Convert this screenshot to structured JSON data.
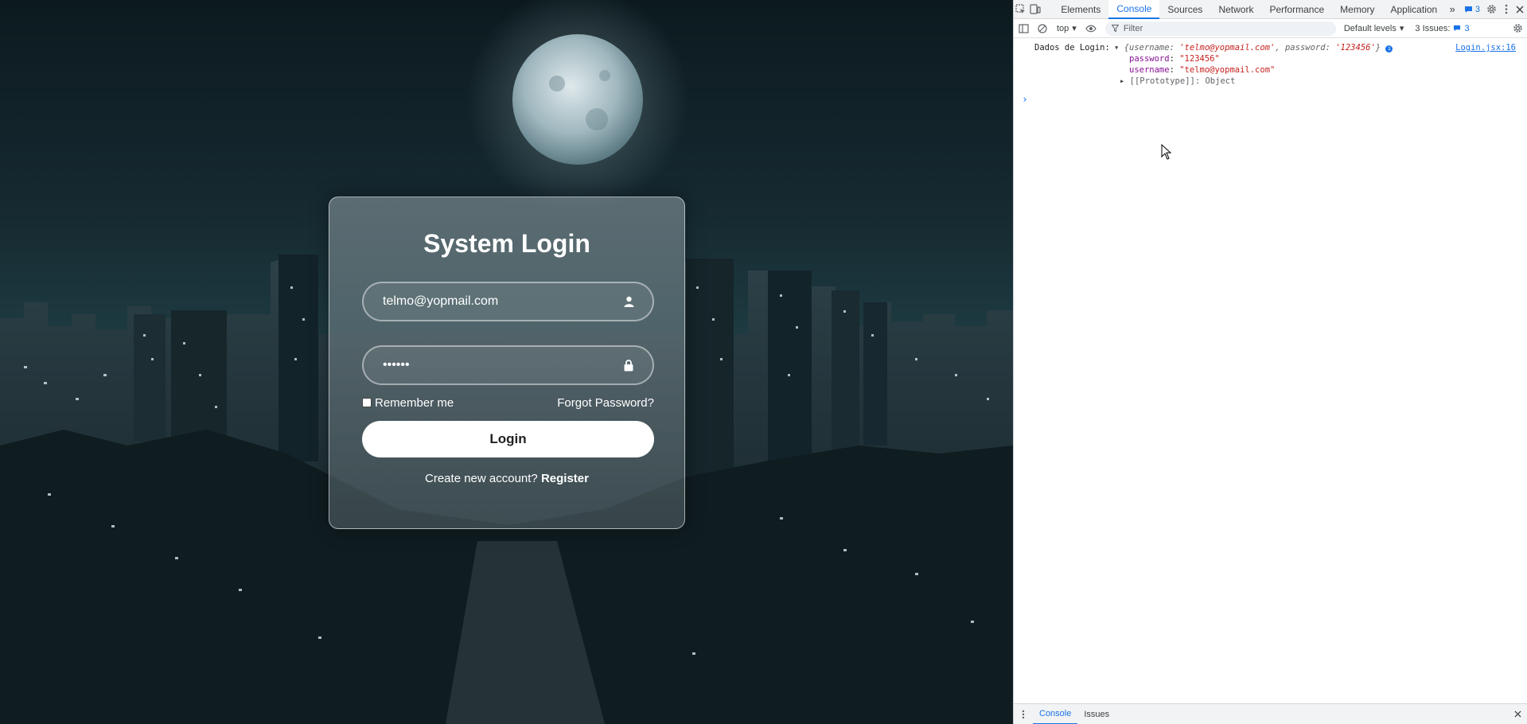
{
  "login": {
    "title": "System Login",
    "username_value": "telmo@yopmail.com",
    "password_value": "123456",
    "remember_label": "Remember me",
    "forgot_label": "Forgot Password?",
    "login_button": "Login",
    "register_prompt": "Create new account?",
    "register_link": "Register"
  },
  "devtools": {
    "tabs": [
      "Elements",
      "Console",
      "Sources",
      "Network",
      "Performance",
      "Memory",
      "Application"
    ],
    "active_tab": "Console",
    "messages_badge": "3",
    "context": "top",
    "filter_placeholder": "Filter",
    "levels": "Default levels",
    "issues_label": "3 Issues:",
    "issues_count": "3",
    "log": {
      "prefix": "Dados de Login:",
      "summary_open": "{",
      "summary_key1": "username",
      "summary_val1": "'telmo@yopmail.com'",
      "summary_key2": "password",
      "summary_val2": "'123456'",
      "summary_close": "}",
      "source": "Login.jsx:16",
      "prop_password_key": "password",
      "prop_password_val": "\"123456\"",
      "prop_username_key": "username",
      "prop_username_val": "\"telmo@yopmail.com\"",
      "prototype": "[[Prototype]]: Object"
    },
    "drawer_tabs": [
      "Console",
      "Issues"
    ]
  },
  "colors": {
    "accent": "#1a73e8",
    "string": "#c5221f",
    "key": "#871094"
  }
}
